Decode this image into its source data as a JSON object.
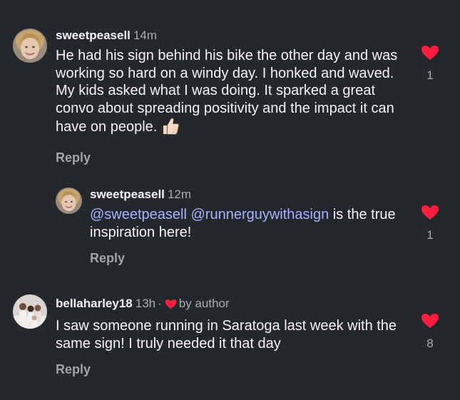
{
  "colors": {
    "background": "#24272c",
    "like_heart": "#ff1f3d",
    "mention": "#a8b4ff",
    "secondary_text": "#a9acb2"
  },
  "comments": [
    {
      "username": "sweetpeasell",
      "time": "14m",
      "text": "He had his sign behind his bike the other day and was working so hard on a windy day. I honked and waved. My kids asked what I was doing. It sparked a great convo about spreading positivity and the impact it can have on people.",
      "emoji_icon": "thumbs-up-icon",
      "reply_label": "Reply",
      "like_count": "1"
    },
    {
      "username": "sweetpeasell",
      "time": "12m",
      "mention_1": "@sweetpeasell",
      "mention_2": "@runnerguywithasign",
      "text_after_mentions": " is the true inspiration here!",
      "reply_label": "Reply",
      "like_count": "1"
    },
    {
      "username": "bellaharley18",
      "time": "13h",
      "separator": "·",
      "author_badge": "by author",
      "text": "I saw someone running in Saratoga last week with the same sign! I truly needed it that day",
      "reply_label": "Reply",
      "like_count": "8"
    }
  ]
}
